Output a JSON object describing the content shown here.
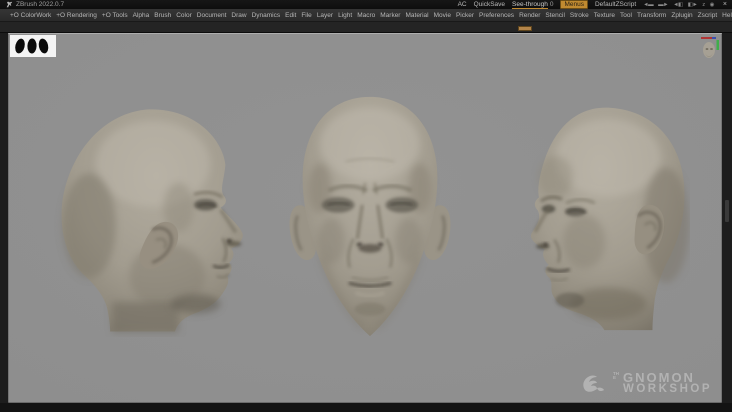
{
  "window": {
    "app_title": "ZBrush 2022.0.7",
    "titlebar": {
      "ac_label": "AC",
      "quicksave_label": "QuickSave",
      "see_through_label": "See-through",
      "see_through_value": "0",
      "menus_label": "Menus",
      "zscript_label": "DefaultZScript",
      "icons": [
        {
          "glyph": "◄▬",
          "name": "scroll-left-tray-icon"
        },
        {
          "glyph": "▬►",
          "name": "scroll-right-tray-icon"
        },
        {
          "glyph": "◄◧",
          "name": "slide-left-tray-icon"
        },
        {
          "glyph": "◧►",
          "name": "slide-right-tray-icon"
        },
        {
          "glyph": "z",
          "name": "zoom-canvas-icon"
        },
        {
          "glyph": "◉",
          "name": "circle-icon"
        }
      ],
      "close_glyph": "×"
    }
  },
  "menubar": {
    "items": [
      "+O ColorWork",
      "+O Rendering",
      "+O Tools",
      "Alpha",
      "Brush",
      "Color",
      "Document",
      "Draw",
      "Dynamics",
      "Edit",
      "File",
      "Layer",
      "Light",
      "Macro",
      "Marker",
      "Material",
      "Movie",
      "Picker",
      "Preferences",
      "Render",
      "Stencil",
      "Stroke",
      "Texture",
      "Tool",
      "Transform",
      "Zplugin",
      "Zscript",
      "Help"
    ]
  },
  "canvas": {
    "watermark": {
      "the": "THE",
      "name": "GNOMON",
      "sub": "WORKSHOP"
    }
  },
  "colors": {
    "accent_orange": "#c08a30",
    "canvas_bg": "#8e8e8e",
    "chrome_bg": "#1d1d1d",
    "menubar_bg": "#2e2e2e",
    "sculpt_base": "#a29c8f"
  }
}
